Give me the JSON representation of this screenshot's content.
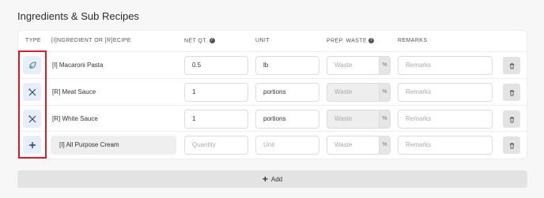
{
  "section_title": "Ingredients & Sub Recipes",
  "headers": {
    "type": "TYPE",
    "ingredient": "[I]NGREDIENT OR [R]ECIPE",
    "net_qt": "NET QT.",
    "unit": "UNIT",
    "prep_waste": "PREP. WASTE",
    "remarks": "REMARKS"
  },
  "rows": [
    {
      "type_icon": "ingredient-leaf-icon",
      "name": "[I] Macaroni Pasta",
      "qty": "0.5",
      "unit": "lb",
      "waste_placeholder": "Waste",
      "waste_unit": "%",
      "remarks_placeholder": "Remarks"
    },
    {
      "type_icon": "recipe-utensils-icon",
      "name": "[R] Meat Sauce",
      "qty": "1",
      "unit": "portions",
      "waste_placeholder": "Waste",
      "waste_unit": "%",
      "remarks_placeholder": "Remarks"
    },
    {
      "type_icon": "recipe-utensils-icon",
      "name": "[R] White Sauce",
      "qty": "1",
      "unit": "portions",
      "waste_placeholder": "Waste",
      "waste_unit": "%",
      "remarks_placeholder": "Remarks"
    },
    {
      "type_icon": "plus-icon",
      "name": "[I] All Purpose Cream",
      "qty_placeholder": "Quantity",
      "unit_placeholder": "Unit",
      "waste_placeholder": "Waste",
      "waste_unit": "%",
      "remarks_placeholder": "Remarks"
    }
  ],
  "add_button": {
    "icon": "+",
    "label": "Add"
  },
  "colors": {
    "highlight": "#d41f2a",
    "type_icon": "#1f3f7a",
    "type_bg": "#e7eef9"
  }
}
